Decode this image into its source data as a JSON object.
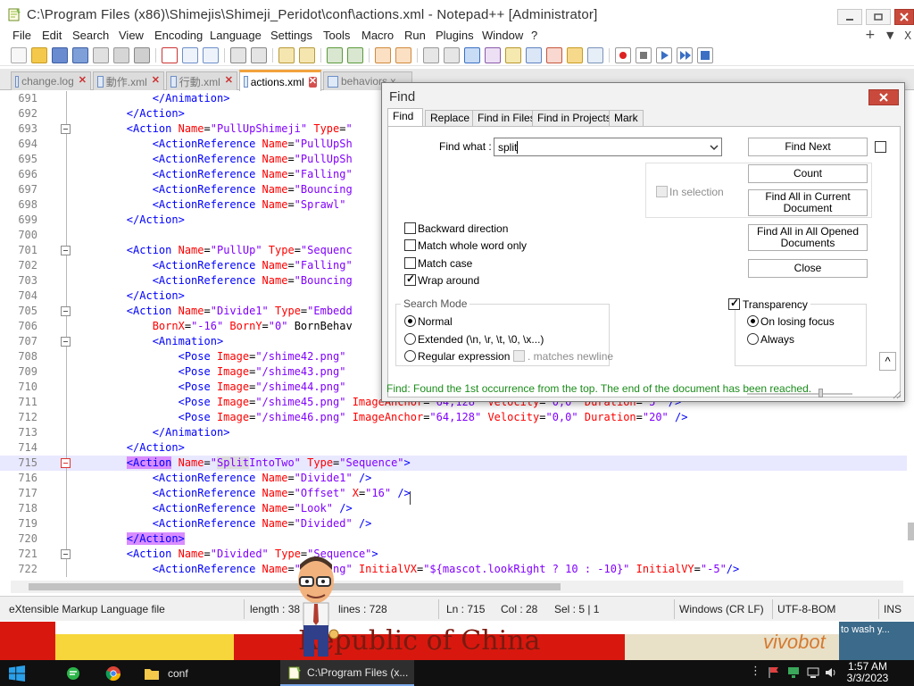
{
  "window": {
    "title": "C:\\Program Files (x86)\\Shimejis\\Shimeji_Peridot\\conf\\actions.xml - Notepad++ [Administrator]"
  },
  "menu": {
    "items": [
      "File",
      "Edit",
      "Search",
      "View",
      "Encoding",
      "Language",
      "Settings",
      "Tools",
      "Macro",
      "Run",
      "Plugins",
      "Window",
      "?"
    ],
    "right": [
      "+",
      "▼",
      "X"
    ]
  },
  "tabs": [
    {
      "label": "change.log",
      "active": false
    },
    {
      "label": "動作.xml",
      "active": false
    },
    {
      "label": "行動.xml",
      "active": false
    },
    {
      "label": "actions.xml",
      "active": true
    },
    {
      "label": "behaviors.x",
      "active": false
    }
  ],
  "editor": {
    "lines": [
      {
        "n": "691",
        "code": "            </Animation>"
      },
      {
        "n": "692",
        "code": "        </Action>"
      },
      {
        "n": "693",
        "code": "        <Action Name=\"PullUpShimeji\" Type=\""
      },
      {
        "n": "694",
        "code": "            <ActionReference Name=\"PullUpSh"
      },
      {
        "n": "695",
        "code": "            <ActionReference Name=\"PullUpSh"
      },
      {
        "n": "696",
        "code": "            <ActionReference Name=\"Falling\""
      },
      {
        "n": "697",
        "code": "            <ActionReference Name=\"Bouncing"
      },
      {
        "n": "698",
        "code": "            <ActionReference Name=\"Sprawl\""
      },
      {
        "n": "699",
        "code": "        </Action>"
      },
      {
        "n": "700",
        "code": ""
      },
      {
        "n": "701",
        "code": "        <Action Name=\"PullUp\" Type=\"Sequenc"
      },
      {
        "n": "702",
        "code": "            <ActionReference Name=\"Falling\""
      },
      {
        "n": "703",
        "code": "            <ActionReference Name=\"Bouncing"
      },
      {
        "n": "704",
        "code": "        </Action>"
      },
      {
        "n": "705",
        "code": "        <Action Name=\"Divide1\" Type=\"Embedd"
      },
      {
        "n": "706",
        "code": "            BornX=\"-16\" BornY=\"0\" BornBehav"
      },
      {
        "n": "707",
        "code": "            <Animation>"
      },
      {
        "n": "708",
        "code": "                <Pose Image=\"/shime42.png\""
      },
      {
        "n": "709",
        "code": "                <Pose Image=\"/shime43.png\""
      },
      {
        "n": "710",
        "code": "                <Pose Image=\"/shime44.png\""
      },
      {
        "n": "711",
        "code": "                <Pose Image=\"/shime45.png\" ImageAnchor=\"64,128\" Velocity=\"0,0\" Duration=\"5\" />"
      },
      {
        "n": "712",
        "code": "                <Pose Image=\"/shime46.png\" ImageAnchor=\"64,128\" Velocity=\"0,0\" Duration=\"20\" />"
      },
      {
        "n": "713",
        "code": "            </Animation>"
      },
      {
        "n": "714",
        "code": "        </Action>"
      },
      {
        "n": "715",
        "code": "        <Action Name=\"SplitIntoTwo\" Type=\"Sequence\">"
      },
      {
        "n": "716",
        "code": "            <ActionReference Name=\"Divide1\" />"
      },
      {
        "n": "717",
        "code": "            <ActionReference Name=\"Offset\" X=\"16\" />"
      },
      {
        "n": "718",
        "code": "            <ActionReference Name=\"Look\" />"
      },
      {
        "n": "719",
        "code": "            <ActionReference Name=\"Divided\" />"
      },
      {
        "n": "720",
        "code": "        </Action>"
      },
      {
        "n": "721",
        "code": "        <Action Name=\"Divided\" Type=\"Sequence\">"
      },
      {
        "n": "722",
        "code": "            <ActionReference Name=\"Falling\" InitialVX=\"${mascot.lookRight ? 10 : -10}\" InitialVY=\"-5\"/>"
      }
    ],
    "current_line": "715",
    "fold_marks": [
      "693",
      "701",
      "705",
      "707",
      "715",
      "721"
    ],
    "red_fold_marks": [
      "715"
    ]
  },
  "statusbar": {
    "file_type": "eXtensible Markup Language file",
    "length": "length : 38",
    "lines": "lines : 728",
    "ln": "Ln : 715",
    "col": "Col : 28",
    "sel": "Sel : 5 | 1",
    "eol": "Windows (CR LF)",
    "encoding": "UTF-8-BOM",
    "ins": "INS"
  },
  "find_dialog": {
    "title": "Find",
    "tabs": [
      "Find",
      "Replace",
      "Find in Files",
      "Find in Projects",
      "Mark"
    ],
    "find_what_label": "Find what :",
    "find_what_value": "split",
    "buttons": {
      "find_next": "Find Next",
      "count": "Count",
      "find_all_current": "Find All in Current Document",
      "find_all_opened": "Find All in All Opened Documents",
      "close": "Close",
      "scroll_up": "^"
    },
    "in_selection": "In selection",
    "options": [
      {
        "label": "Backward direction",
        "checked": false
      },
      {
        "label": "Match whole word only",
        "checked": false
      },
      {
        "label": "Match case",
        "checked": false
      },
      {
        "label": "Wrap around",
        "checked": true
      }
    ],
    "search_mode": {
      "title": "Search Mode",
      "normal": "Normal",
      "extended": "Extended (\\n, \\r, \\t, \\0, \\x...)",
      "regex": "Regular expression",
      "matches_newline": ". matches newline",
      "selected": "Normal"
    },
    "transparency": {
      "label": "Transparency",
      "checked": true,
      "on_losing_focus": "On losing focus",
      "always": "Always",
      "selected": "On losing focus",
      "level": 0.72
    },
    "status": "Find: Found the 1st occurrence from the top. The end of the document has been reached."
  },
  "wallpaper": {
    "text": "Republic of China",
    "text2": "vivobot",
    "text3": "to wash y..."
  },
  "taskbar": {
    "items": [
      {
        "label": "conf"
      },
      {
        "label": "C:\\Program Files (x..."
      }
    ],
    "time": "1:57 AM",
    "date": "3/3/2023"
  }
}
